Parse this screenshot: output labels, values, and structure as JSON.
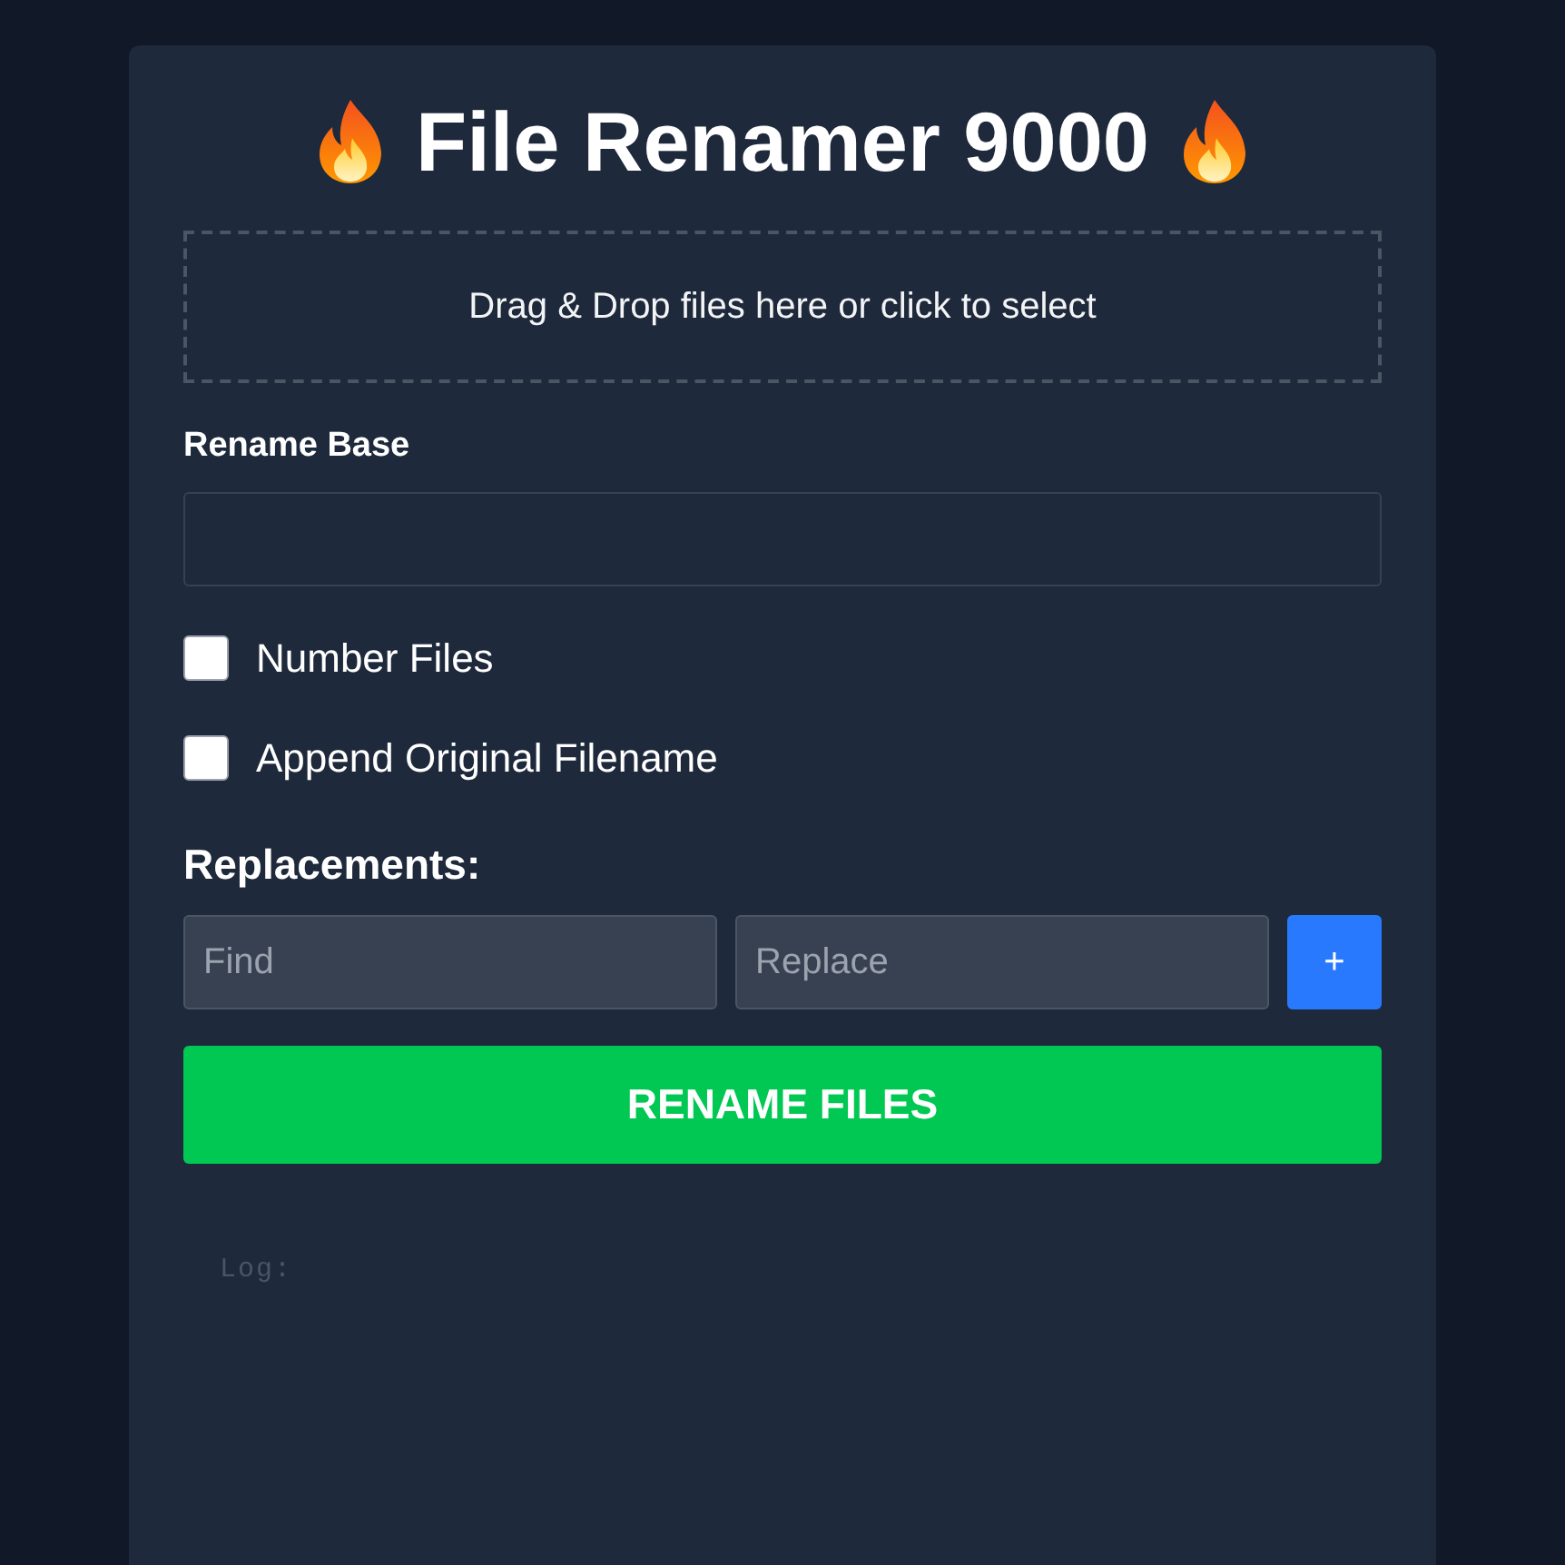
{
  "title": "File Renamer 9000",
  "dropzone": {
    "text": "Drag & Drop files here or click to select"
  },
  "rename_base": {
    "label": "Rename Base"
  },
  "options": [
    {
      "label": "Number Files",
      "checked": false
    },
    {
      "label": "Append Original Filename",
      "checked": false
    }
  ],
  "replacements": {
    "heading": "Replacements:",
    "find_placeholder": "Find",
    "replace_placeholder": "Replace",
    "add_button": "+"
  },
  "rename_button": "RENAME FILES",
  "log": {
    "placeholder": "Log:"
  }
}
